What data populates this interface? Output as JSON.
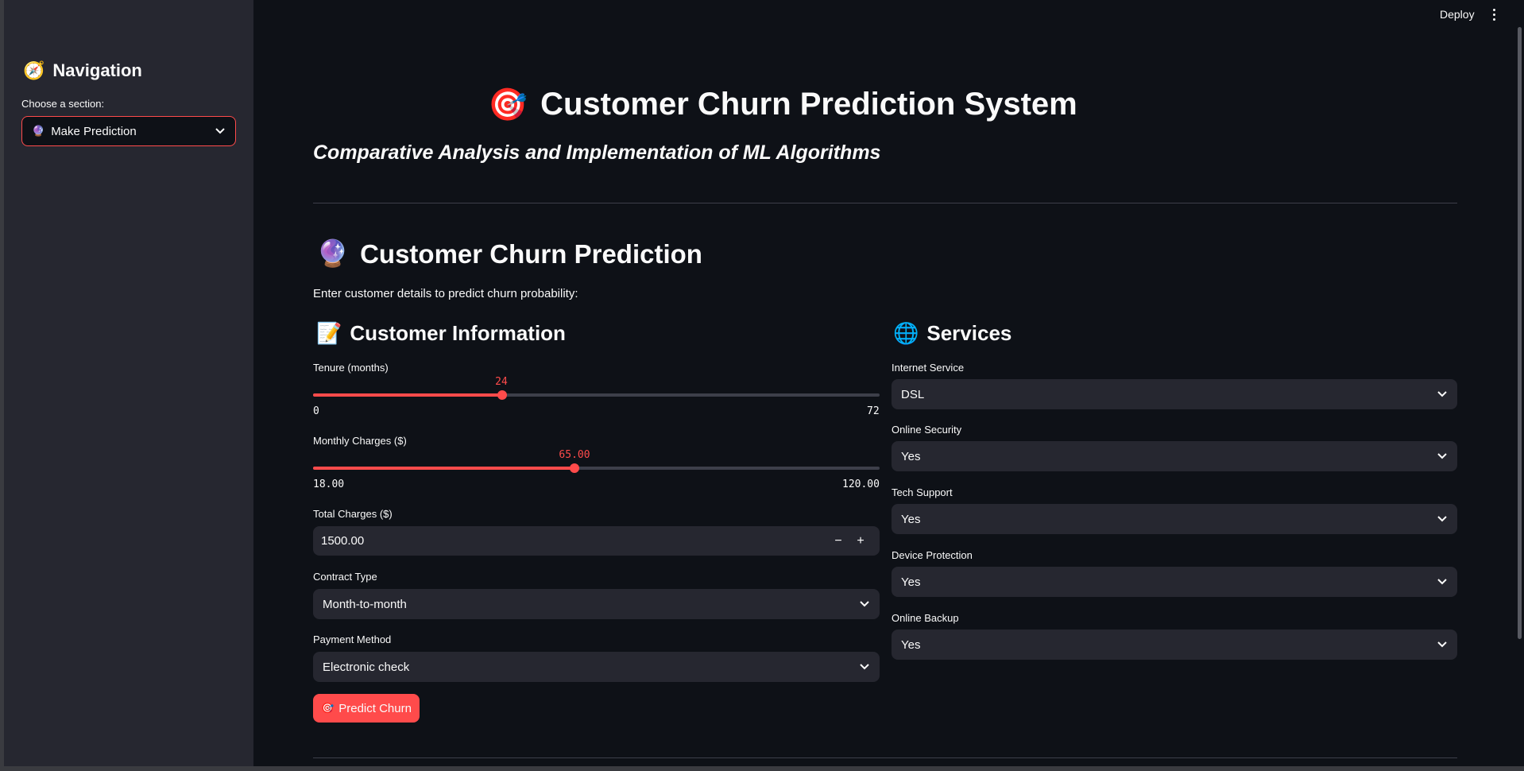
{
  "colors": {
    "accent": "#ff4b4b",
    "background": "#0e1117",
    "sidebar": "#262730",
    "widget": "#262730"
  },
  "topbar": {
    "deploy_label": "Deploy",
    "menu_icon": "kebab-menu-icon"
  },
  "sidebar": {
    "title": "Navigation",
    "title_emoji": "🧭",
    "select_label": "Choose a section:",
    "select_emoji": "🔮",
    "select_value": "Make Prediction"
  },
  "header": {
    "title_emoji": "🎯",
    "title": "Customer Churn Prediction System",
    "subtitle": "Comparative Analysis and Implementation of ML Algorithms"
  },
  "prediction": {
    "title_emoji": "🔮",
    "title": "Customer Churn Prediction",
    "description": "Enter customer details to predict churn probability:"
  },
  "customer_info": {
    "title_emoji": "📝",
    "title": "Customer Information",
    "tenure": {
      "label": "Tenure (months)",
      "value": "24",
      "min": "0",
      "max": "72",
      "fraction": 0.3333
    },
    "monthly_charges": {
      "label": "Monthly Charges ($)",
      "value": "65.00",
      "min": "18.00",
      "max": "120.00",
      "fraction": 0.4608
    },
    "total_charges": {
      "label": "Total Charges ($)",
      "value": "1500.00",
      "minus": "−",
      "plus": "+"
    },
    "contract": {
      "label": "Contract Type",
      "value": "Month-to-month"
    },
    "payment": {
      "label": "Payment Method",
      "value": "Electronic check"
    }
  },
  "services": {
    "title_emoji": "🌐",
    "title": "Services",
    "internet": {
      "label": "Internet Service",
      "value": "DSL"
    },
    "online_security": {
      "label": "Online Security",
      "value": "Yes"
    },
    "tech_support": {
      "label": "Tech Support",
      "value": "Yes"
    },
    "device_protection": {
      "label": "Device Protection",
      "value": "Yes"
    },
    "online_backup": {
      "label": "Online Backup",
      "value": "Yes"
    }
  },
  "predict_button": {
    "emoji": "🎯",
    "label": "Predict Churn"
  }
}
